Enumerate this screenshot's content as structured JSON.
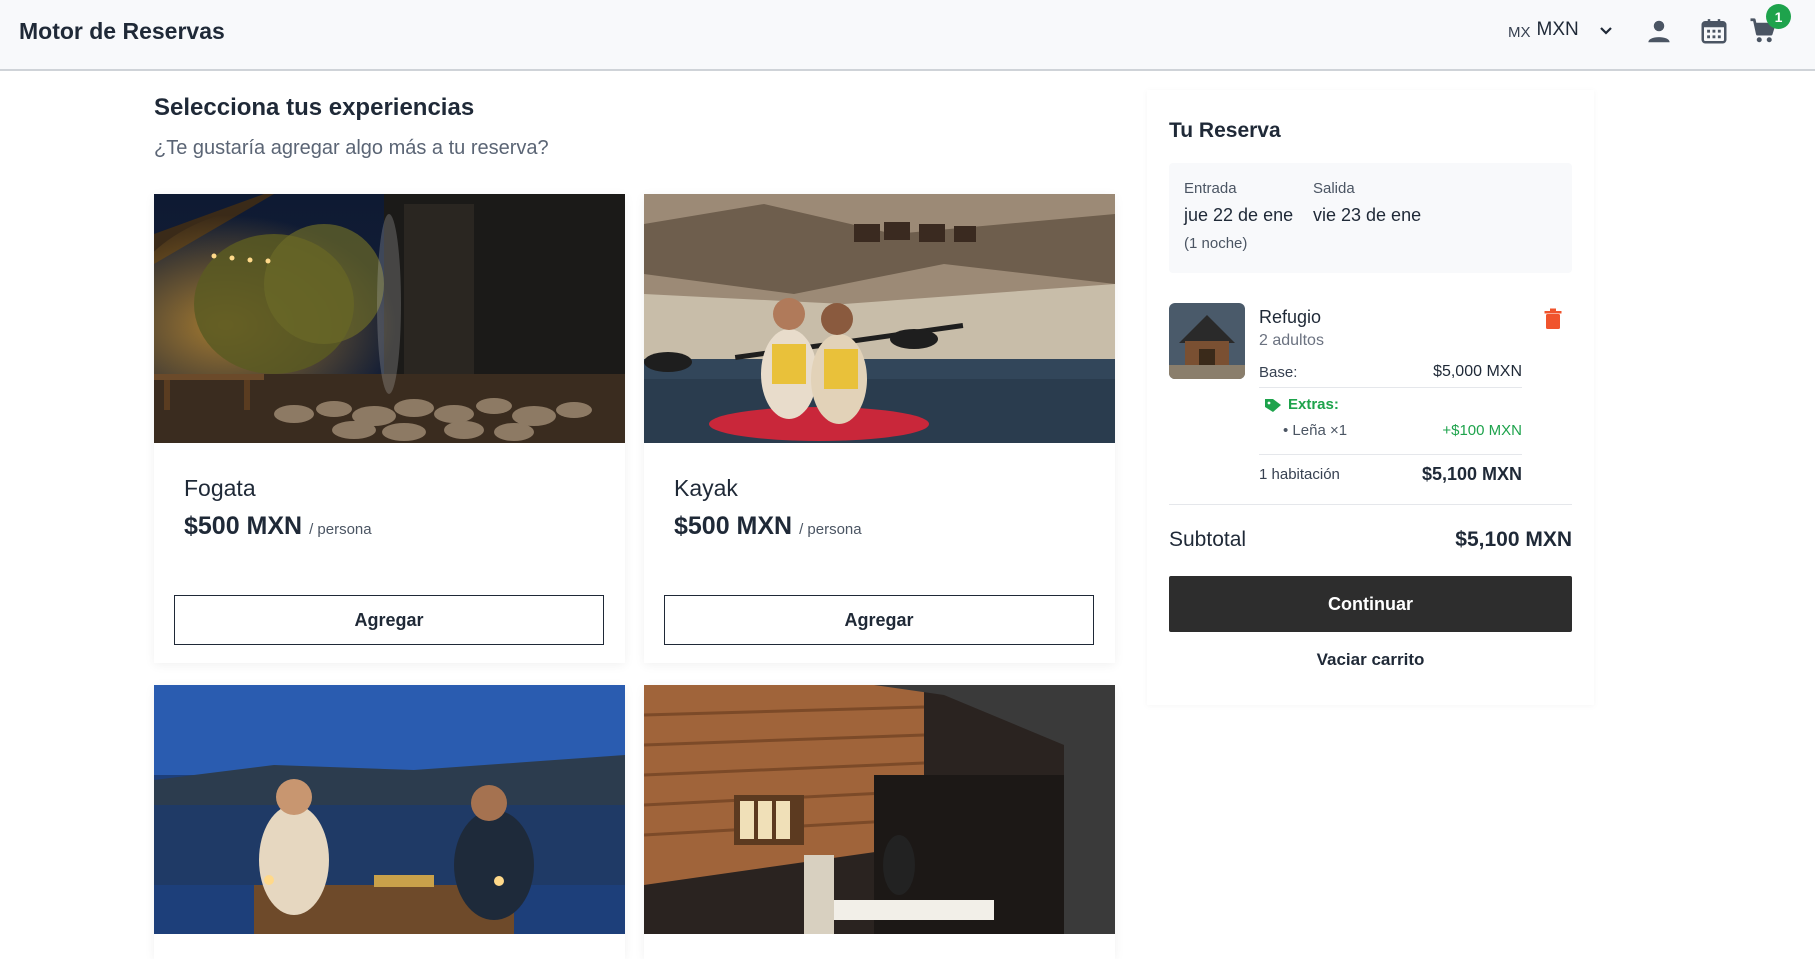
{
  "header": {
    "brand": "Motor de Reservas",
    "currency_flag": "MX",
    "currency_code": "MXN",
    "cart_count": "1",
    "icons": [
      "user-icon",
      "calendar-icon",
      "cart-icon"
    ]
  },
  "main": {
    "title": "Selecciona tus experiencias",
    "subtitle": "¿Te gustaría agregar algo más a tu reserva?",
    "experiences": [
      {
        "name": "Fogata",
        "price": "$500 MXN",
        "unit": "/ persona",
        "button": "Agregar"
      },
      {
        "name": "Kayak",
        "price": "$500 MXN",
        "unit": "/ persona",
        "button": "Agregar"
      }
    ]
  },
  "reservation": {
    "title": "Tu Reserva",
    "checkin_label": "Entrada",
    "checkin_value": "jue 22 de ene",
    "checkout_label": "Salida",
    "checkout_value": "vie 23 de ene",
    "nights": "(1 noche)",
    "item": {
      "name": "Refugio",
      "guests": "2 adultos",
      "base_label": "Base:",
      "base_value": "$5,000 MXN",
      "extras_label": "Extras:",
      "extra_name": "• Leña ×1",
      "extra_value": "+$100 MXN",
      "rooms_label": "1 habitación",
      "rooms_total": "$5,100 MXN"
    },
    "subtotal_label": "Subtotal",
    "subtotal_value": "$5,100 MXN",
    "continue_label": "Continuar",
    "empty_label": "Vaciar carrito"
  },
  "colors": {
    "accent_green": "#1ea34c",
    "delete_red": "#f0542d",
    "button_dark": "#2d2d2d"
  }
}
